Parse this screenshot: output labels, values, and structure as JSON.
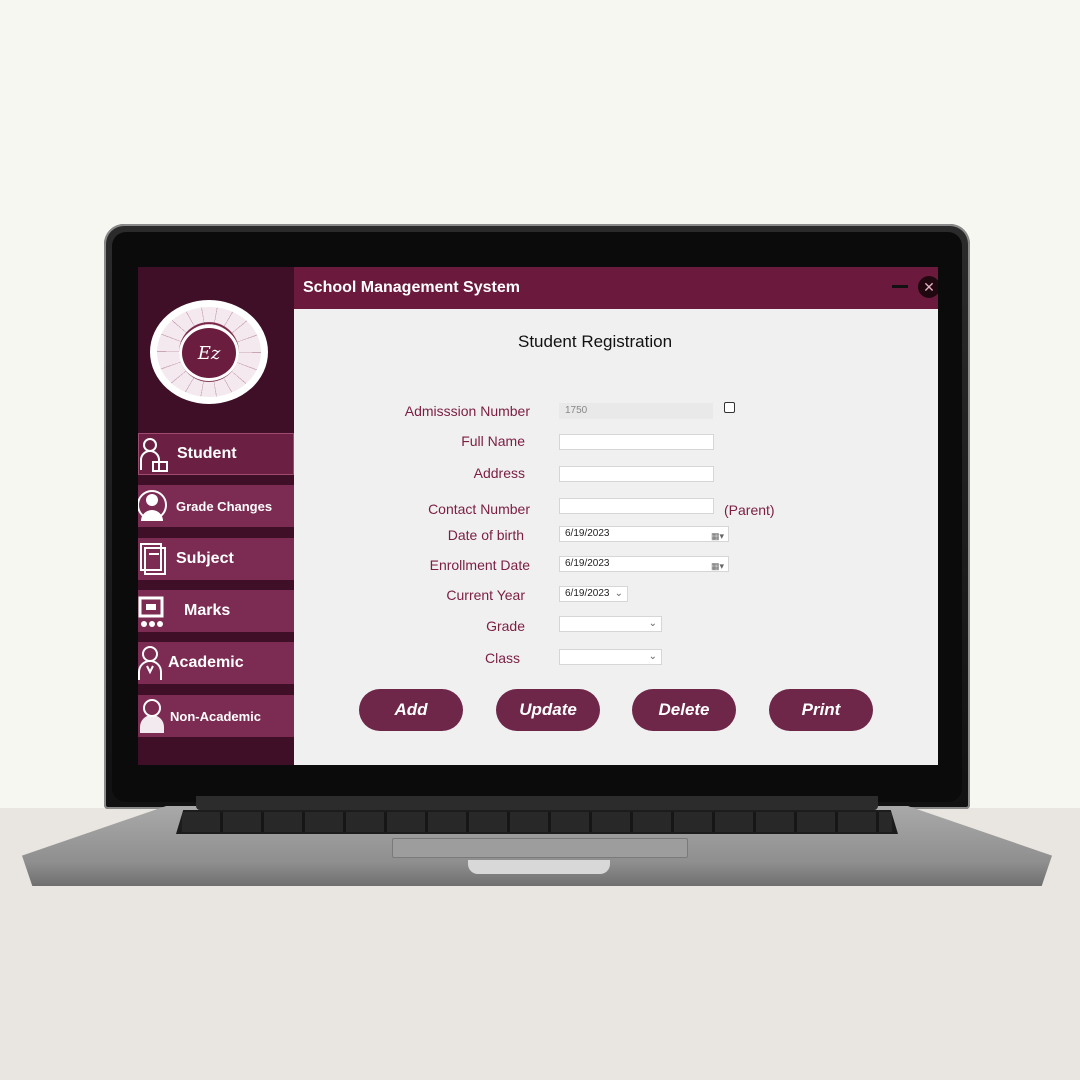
{
  "window": {
    "title": "School Management System"
  },
  "logo": {
    "text": "Ez"
  },
  "sidebar": {
    "items": [
      {
        "label": "Student"
      },
      {
        "label": "Grade Changes"
      },
      {
        "label": "Subject"
      },
      {
        "label": "Marks"
      },
      {
        "label": "Academic"
      },
      {
        "label": "Non-Academic"
      }
    ]
  },
  "form": {
    "title": "Student Registration",
    "admission_label": "Admisssion Number",
    "admission_value": "1750",
    "full_name_label": "Full Name",
    "full_name_value": "",
    "address_label": "Address",
    "address_value": "",
    "contact_label": "Contact Number",
    "contact_value": "",
    "contact_note": "(Parent)",
    "dob_label": "Date of birth",
    "dob_value": "6/19/2023",
    "enroll_label": "Enrollment Date",
    "enroll_value": "6/19/2023",
    "year_label": "Current Year",
    "year_value": "6/19/2023",
    "grade_label": "Grade",
    "grade_value": "",
    "class_label": "Class",
    "class_value": ""
  },
  "buttons": {
    "add": "Add",
    "update": "Update",
    "delete": "Delete",
    "print": "Print"
  },
  "colors": {
    "accent": "#6b1a3e",
    "sidebar": "#3f0f28",
    "nav_item": "#7c2c52",
    "label": "#7a1e42"
  }
}
